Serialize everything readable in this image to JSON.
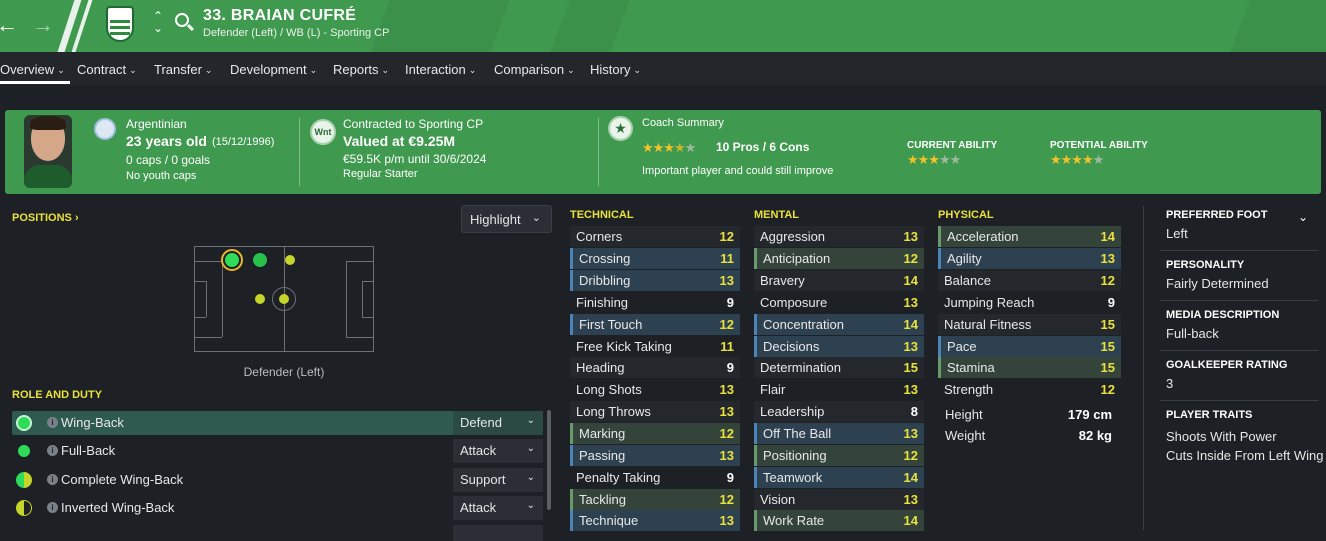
{
  "header": {
    "player_title": "33. BRAIAN CUFRÉ",
    "player_subtitle": "Defender (Left) / WB (L) - Sporting CP",
    "accent_color": "#3f9a4f"
  },
  "tabs": [
    {
      "label": "Overview"
    },
    {
      "label": "Contract"
    },
    {
      "label": "Transfer"
    },
    {
      "label": "Development"
    },
    {
      "label": "Reports"
    },
    {
      "label": "Interaction"
    },
    {
      "label": "Comparison"
    },
    {
      "label": "History"
    }
  ],
  "banner": {
    "nationality": "Argentinian",
    "age": "23 years old",
    "dob": "(15/12/1996)",
    "caps": "0 caps / 0 goals",
    "youth_caps": "No youth caps",
    "contract_badge": "Wnt",
    "contract_club": "Contracted to Sporting CP",
    "value": "Valued at €9.25M",
    "wage": "€59.5K p/m until 30/6/2024",
    "squad_status": "Regular Starter",
    "coach_title": "Coach Summary",
    "pros_cons": "10 Pros / 6 Cons",
    "coach_rating_stars": 3.5,
    "coach_comment": "Important player and could still improve",
    "current_ability_label": "CURRENT ABILITY",
    "current_ability_stars": 3,
    "potential_ability_label": "POTENTIAL ABILITY",
    "potential_ability_stars": 4
  },
  "positions": {
    "title": "POSITIONS",
    "highlight_label": "Highlight",
    "position_label": "Defender (Left)"
  },
  "roles": {
    "title": "ROLE AND DUTY",
    "items": [
      {
        "name": "Wing-Back",
        "duty": "Defend",
        "suitability": "full"
      },
      {
        "name": "Full-Back",
        "duty": "Attack",
        "suitability": "full"
      },
      {
        "name": "Complete Wing-Back",
        "duty": "Support",
        "suitability": "half"
      },
      {
        "name": "Inverted Wing-Back",
        "duty": "Attack",
        "suitability": "half"
      }
    ]
  },
  "attributes": {
    "technical": {
      "title": "TECHNICAL",
      "items": [
        {
          "name": "Corners",
          "value": "12"
        },
        {
          "name": "Crossing",
          "value": "11"
        },
        {
          "name": "Dribbling",
          "value": "13"
        },
        {
          "name": "Finishing",
          "value": "9"
        },
        {
          "name": "First Touch",
          "value": "12"
        },
        {
          "name": "Free Kick Taking",
          "value": "11"
        },
        {
          "name": "Heading",
          "value": "9"
        },
        {
          "name": "Long Shots",
          "value": "13"
        },
        {
          "name": "Long Throws",
          "value": "13"
        },
        {
          "name": "Marking",
          "value": "12"
        },
        {
          "name": "Passing",
          "value": "13"
        },
        {
          "name": "Penalty Taking",
          "value": "9"
        },
        {
          "name": "Tackling",
          "value": "12"
        },
        {
          "name": "Technique",
          "value": "13"
        }
      ]
    },
    "mental": {
      "title": "MENTAL",
      "items": [
        {
          "name": "Aggression",
          "value": "13"
        },
        {
          "name": "Anticipation",
          "value": "12"
        },
        {
          "name": "Bravery",
          "value": "14"
        },
        {
          "name": "Composure",
          "value": "13"
        },
        {
          "name": "Concentration",
          "value": "14"
        },
        {
          "name": "Decisions",
          "value": "13"
        },
        {
          "name": "Determination",
          "value": "15"
        },
        {
          "name": "Flair",
          "value": "13"
        },
        {
          "name": "Leadership",
          "value": "8"
        },
        {
          "name": "Off The Ball",
          "value": "13"
        },
        {
          "name": "Positioning",
          "value": "12"
        },
        {
          "name": "Teamwork",
          "value": "14"
        },
        {
          "name": "Vision",
          "value": "13"
        },
        {
          "name": "Work Rate",
          "value": "14"
        }
      ]
    },
    "physical": {
      "title": "PHYSICAL",
      "items": [
        {
          "name": "Acceleration",
          "value": "14"
        },
        {
          "name": "Agility",
          "value": "13"
        },
        {
          "name": "Balance",
          "value": "12"
        },
        {
          "name": "Jumping Reach",
          "value": "9"
        },
        {
          "name": "Natural Fitness",
          "value": "15"
        },
        {
          "name": "Pace",
          "value": "15"
        },
        {
          "name": "Stamina",
          "value": "15"
        },
        {
          "name": "Strength",
          "value": "12"
        }
      ],
      "height_label": "Height",
      "height_value": "179 cm",
      "weight_label": "Weight",
      "weight_value": "82 kg"
    }
  },
  "info": {
    "preferred_foot_label": "PREFERRED FOOT",
    "preferred_foot": "Left",
    "personality_label": "PERSONALITY",
    "personality": "Fairly Determined",
    "media_label": "MEDIA DESCRIPTION",
    "media": "Full-back",
    "gk_label": "GOALKEEPER RATING",
    "gk_rating": "3",
    "traits_label": "PLAYER TRAITS",
    "traits": [
      "Shoots With Power",
      "Cuts Inside From Left Wing"
    ]
  }
}
